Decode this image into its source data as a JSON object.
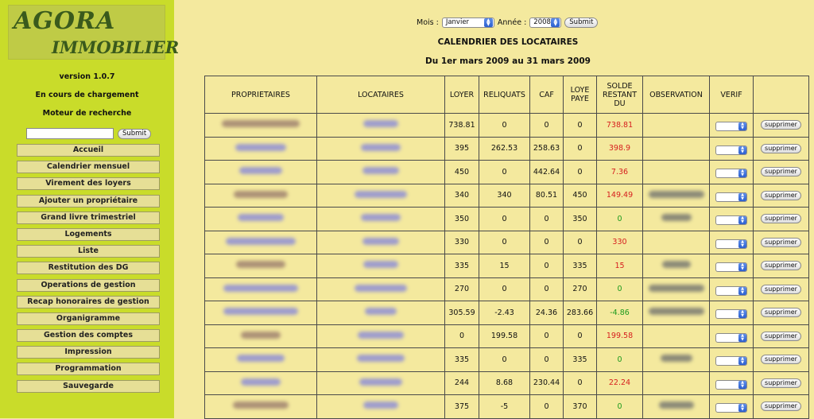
{
  "sidebar": {
    "logo_line1": "AGORA",
    "logo_line2": "IMMOBILIER",
    "version": "version 1.0.7",
    "loading": "En cours de chargement",
    "search_title": "Moteur de recherche",
    "search_value": "",
    "submit_label": "Submit",
    "menu": [
      "Accueil",
      "Calendrier mensuel",
      "Virement des loyers",
      "Ajouter un propriétaire",
      "Grand livre trimestriel",
      "Logements",
      "Liste",
      "Restitution des DG",
      "Operations de gestion",
      "Recap honoraires de gestion",
      "Organigramme",
      "Gestion des comptes",
      "Impression",
      "Programmation",
      "Sauvegarde"
    ]
  },
  "filter": {
    "month_label": "Mois :",
    "month_value": "Janvier",
    "year_label": "Année :",
    "year_value": "2008",
    "submit_label": "Submit"
  },
  "page": {
    "title": "CALENDRIER DES LOCATAIRES",
    "subtitle": "Du 1er mars 2009 au 31 mars 2009"
  },
  "table": {
    "headers": [
      "PROPRIETAIRES",
      "LOCATAIRES",
      "LOYER",
      "RELIQUATS",
      "CAF",
      "LOYE PAYE",
      "SOLDE RESTANT DU",
      "OBSERVATION",
      "VERIF",
      ""
    ],
    "delete_label": "supprimer",
    "rows": [
      {
        "loyer": "738.81",
        "reliquats": "0",
        "caf": "0",
        "paye": "0",
        "solde": "738.81",
        "status": "neg",
        "obs": false
      },
      {
        "loyer": "395",
        "reliquats": "262.53",
        "caf": "258.63",
        "paye": "0",
        "solde": "398.9",
        "status": "neg",
        "obs": false
      },
      {
        "loyer": "450",
        "reliquats": "0",
        "caf": "442.64",
        "paye": "0",
        "solde": "7.36",
        "status": "neg",
        "obs": false
      },
      {
        "loyer": "340",
        "reliquats": "340",
        "caf": "80.51",
        "paye": "450",
        "solde": "149.49",
        "status": "neg",
        "obs": true
      },
      {
        "loyer": "350",
        "reliquats": "0",
        "caf": "0",
        "paye": "350",
        "solde": "0",
        "status": "pos",
        "obs": true
      },
      {
        "loyer": "330",
        "reliquats": "0",
        "caf": "0",
        "paye": "0",
        "solde": "330",
        "status": "neg",
        "obs": false
      },
      {
        "loyer": "335",
        "reliquats": "15",
        "caf": "0",
        "paye": "335",
        "solde": "15",
        "status": "neg",
        "obs": true
      },
      {
        "loyer": "270",
        "reliquats": "0",
        "caf": "0",
        "paye": "270",
        "solde": "0",
        "status": "pos",
        "obs": true
      },
      {
        "loyer": "305.59",
        "reliquats": "-2.43",
        "caf": "24.36",
        "paye": "283.66",
        "solde": "-4.86",
        "status": "pos",
        "obs": true
      },
      {
        "loyer": "0",
        "reliquats": "199.58",
        "caf": "0",
        "paye": "0",
        "solde": "199.58",
        "status": "neg",
        "obs": false
      },
      {
        "loyer": "335",
        "reliquats": "0",
        "caf": "0",
        "paye": "335",
        "solde": "0",
        "status": "pos",
        "obs": true
      },
      {
        "loyer": "244",
        "reliquats": "8.68",
        "caf": "230.44",
        "paye": "0",
        "solde": "22.24",
        "status": "neg",
        "obs": false
      },
      {
        "loyer": "375",
        "reliquats": "-5",
        "caf": "0",
        "paye": "370",
        "solde": "0",
        "status": "pos",
        "obs": true
      }
    ]
  },
  "colors": {
    "sidebar_bg": "#c9dc2a",
    "main_bg": "#f4e99e",
    "negative": "#d61e1e",
    "positive": "#1c9a1c"
  }
}
